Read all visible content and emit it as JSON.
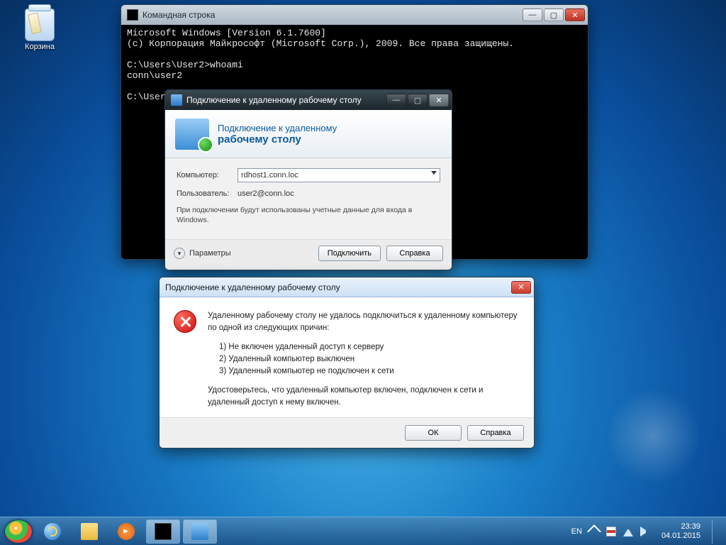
{
  "desktop": {
    "recycle_bin": "Корзина"
  },
  "cmd": {
    "title": "Командная строка",
    "lines": "Microsoft Windows [Version 6.1.7600]\n(c) Корпорация Майкрософт (Microsoft Corp.), 2009. Все права защищены.\n\nC:\\Users\\User2>whoami\nconn\\user2\n\nC:\\Users\\User2>"
  },
  "rdp": {
    "title": "Подключение к удаленному рабочему столу",
    "banner_line1": "Подключение к удаленному",
    "banner_line2": "рабочему столу",
    "computer_label": "Компьютер:",
    "computer_value": "rdhost1.conn.loc",
    "user_label": "Пользователь:",
    "user_value": "user2@conn.loc",
    "note": "При подключении будут использованы учетные данные для входа в Windows.",
    "params": "Параметры",
    "connect_btn": "Подключить",
    "help_btn": "Справка"
  },
  "err": {
    "title": "Подключение к удаленному рабочему столу",
    "intro": "Удаленному рабочему столу не удалось подключиться к удаленному компьютеру по одной из следующих причин:",
    "r1": "1) Не включен удаленный доступ к серверу",
    "r2": "2) Удаленный компьютер выключен",
    "r3": "3) Удаленный компьютер не подключен к сети",
    "outro": "Удостоверьтесь, что удаленный компьютер включен, подключен к сети и удаленный доступ к нему включен.",
    "ok_btn": "ОК",
    "help_btn": "Справка"
  },
  "tray": {
    "lang": "EN",
    "time": "23:39",
    "date": "04.01.2015"
  }
}
